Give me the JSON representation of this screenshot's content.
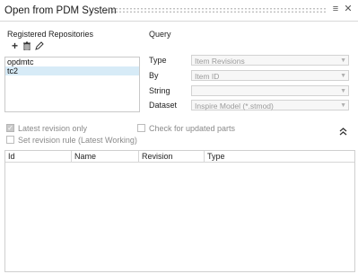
{
  "window": {
    "title": "Open from PDM System",
    "menu_icon": "hamburger-menu-icon",
    "close_icon": "close-icon"
  },
  "repositories": {
    "heading": "Registered Repositories",
    "toolbar": {
      "add_icon": "plus-icon",
      "delete_icon": "trash-icon",
      "edit_icon": "pencil-icon"
    },
    "items": [
      {
        "label": "opdmtc",
        "selected": false
      },
      {
        "label": "tc2",
        "selected": true
      }
    ]
  },
  "query": {
    "heading": "Query",
    "fields": [
      {
        "label": "Type",
        "value": "Item Revisions"
      },
      {
        "label": "By",
        "value": "Item ID"
      },
      {
        "label": "String",
        "value": ""
      },
      {
        "label": "Dataset",
        "value": "Inspire Model (*.stmod)"
      }
    ]
  },
  "options": {
    "latest_revision": {
      "label": "Latest revision only",
      "checked": true
    },
    "set_revision_rule": {
      "label": "Set revision rule (Latest Working)",
      "checked": false
    },
    "check_updated": {
      "label": "Check for updated parts",
      "checked": false
    },
    "collapse_icon": "double-chevron-up-icon"
  },
  "results_table": {
    "columns": [
      "Id",
      "Name",
      "Revision",
      "Type"
    ],
    "rows": []
  }
}
